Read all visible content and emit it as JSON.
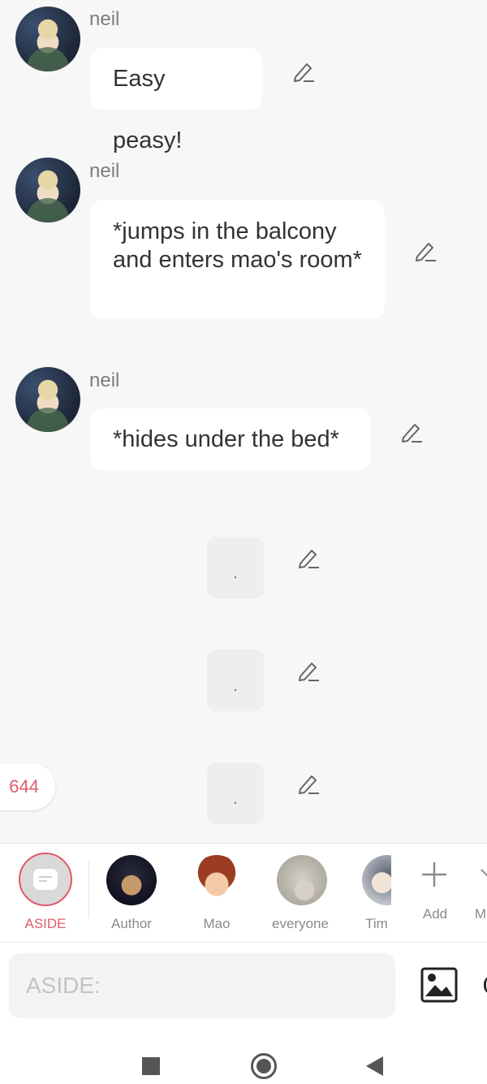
{
  "messages": [
    {
      "sender": "neil",
      "text": "Easy peasy!"
    },
    {
      "sender": "neil",
      "text": "*jumps in the balcony and enters mao's room*"
    },
    {
      "sender": "neil",
      "text": "*hides under the bed*"
    }
  ],
  "placeholders": [
    ".",
    ".",
    "."
  ],
  "counter": "644",
  "characters": [
    {
      "name": "ASIDE",
      "selected": true
    },
    {
      "name": "Author"
    },
    {
      "name": "Mao"
    },
    {
      "name": "everyone"
    },
    {
      "name": "Tim"
    },
    {
      "name": "Add"
    },
    {
      "name": "M"
    }
  ],
  "input": {
    "placeholder": "ASIDE:",
    "value": ""
  },
  "colors": {
    "accent": "#e05a6b",
    "background": "#f7f7f7",
    "bubble": "#ffffff"
  }
}
